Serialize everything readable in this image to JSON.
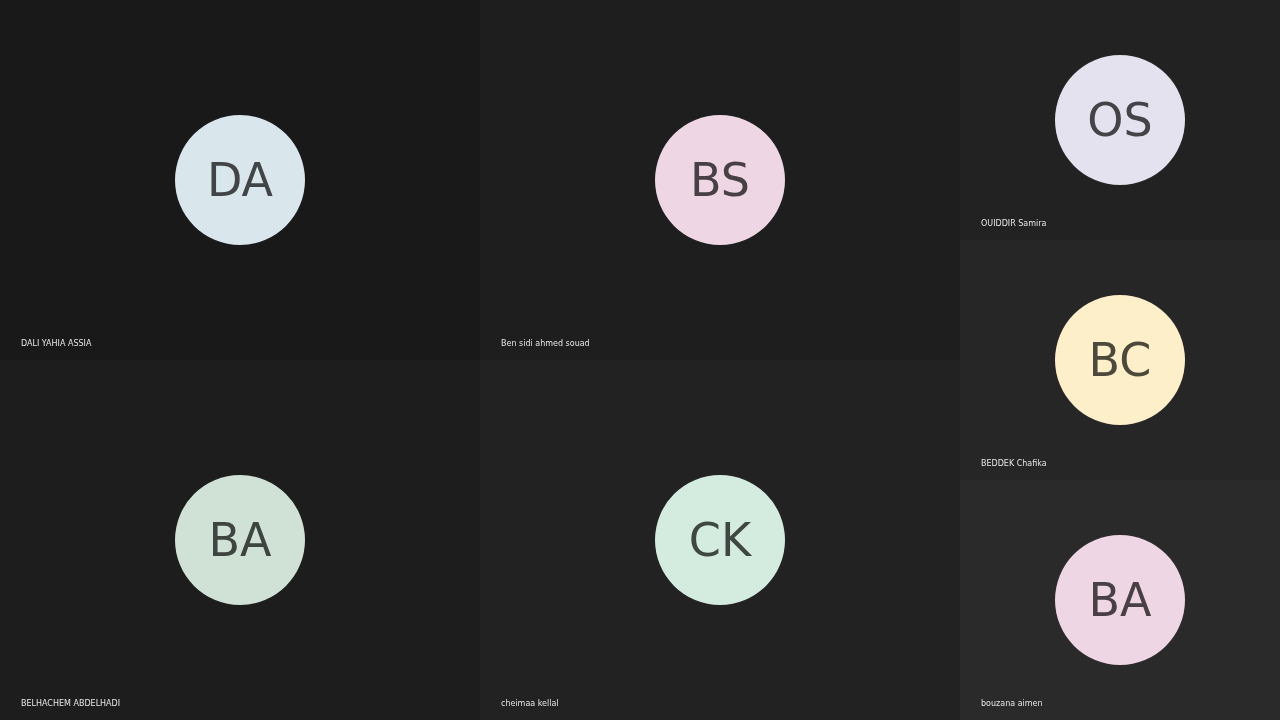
{
  "main_tiles": [
    {
      "initials": "DA",
      "name": "DALI YAHIA ASSIA",
      "color": "#d9e6ec"
    },
    {
      "initials": "BS",
      "name": "Ben sidi ahmed souad",
      "color": "#efd6e4"
    },
    {
      "initials": "BA",
      "name": "BELHACHEM ABDELHADI",
      "color": "#d0e2d6"
    },
    {
      "initials": "CK",
      "name": "cheimaa kellal",
      "color": "#d3ecdf"
    }
  ],
  "side_tiles": [
    {
      "initials": "OS",
      "name": "OUIDDIR Samira",
      "color": "#e4e2ef"
    },
    {
      "initials": "BC",
      "name": "BEDDEK Chafika",
      "color": "#fdefc9"
    },
    {
      "initials": "BA",
      "name": "bouzana aimen",
      "color": "#efd6e4"
    }
  ]
}
